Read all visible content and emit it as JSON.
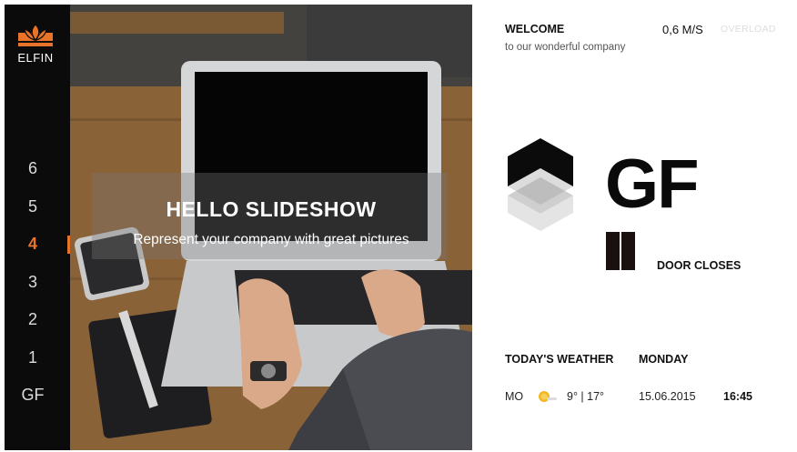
{
  "brand": {
    "logo_text": "ELFIN",
    "accent_color": "#e8742a",
    "logo_icon": "lotus-icon"
  },
  "sidebar": {
    "floors": [
      {
        "label": "6",
        "active": false
      },
      {
        "label": "5",
        "active": false
      },
      {
        "label": "4",
        "active": true
      },
      {
        "label": "3",
        "active": false
      },
      {
        "label": "2",
        "active": false
      },
      {
        "label": "1",
        "active": false
      },
      {
        "label": "GF",
        "active": false
      }
    ]
  },
  "slideshow": {
    "title": "HELLO SLIDESHOW",
    "subtitle": "Represent your company with great pictures"
  },
  "header": {
    "welcome": "WELCOME",
    "welcome_sub": "to our wonderful company",
    "speed": "0,6 M/S",
    "overload": "OVERLOAD"
  },
  "elevator": {
    "current_floor": "GF",
    "direction_icon": "elevator-direction-icon",
    "door_icon": "door-icon",
    "door_status": "DOOR CLOSES"
  },
  "weather": {
    "title": "TODAY'S WEATHER",
    "day_name": "MONDAY",
    "day_short": "MO",
    "icon": "sun-cloud-icon",
    "temps": "9° | 17°",
    "date": "15.06.2015",
    "time": "16:45"
  }
}
